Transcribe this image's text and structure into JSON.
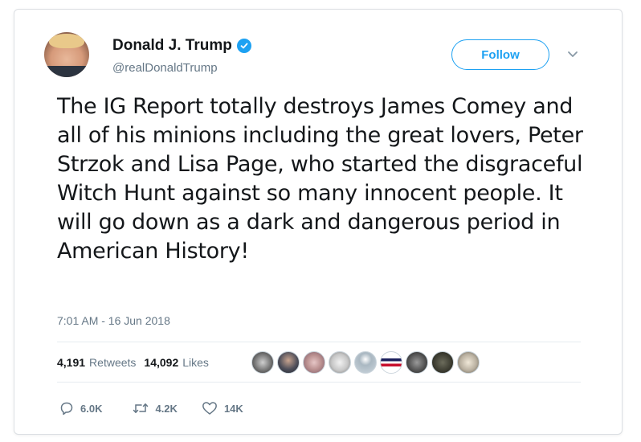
{
  "tweet": {
    "author_name": "Donald J. Trump",
    "handle": "@realDonaldTrump",
    "follow_label": "Follow",
    "text": "The IG Report totally destroys James Comey and all of his minions including the great lovers, Peter Strzok and Lisa Page, who started the disgraceful Witch Hunt against so many innocent people. It will go down as a dark and dangerous period in American History!",
    "timestamp": "7:01 AM - 16 Jun 2018",
    "retweets_count": "4,191",
    "retweets_label": "Retweets",
    "likes_count": "14,092",
    "likes_label": "Likes",
    "reply_count": "6.0K",
    "retweet_action_count": "4.2K",
    "like_action_count": "14K"
  },
  "colors": {
    "accent": "#1da1f2",
    "muted": "#657786",
    "text": "#14171a"
  },
  "icons": {
    "verified": "verified-badge-icon",
    "caret": "chevron-down-icon",
    "reply": "reply-icon",
    "retweet": "retweet-icon",
    "like": "heart-icon"
  }
}
